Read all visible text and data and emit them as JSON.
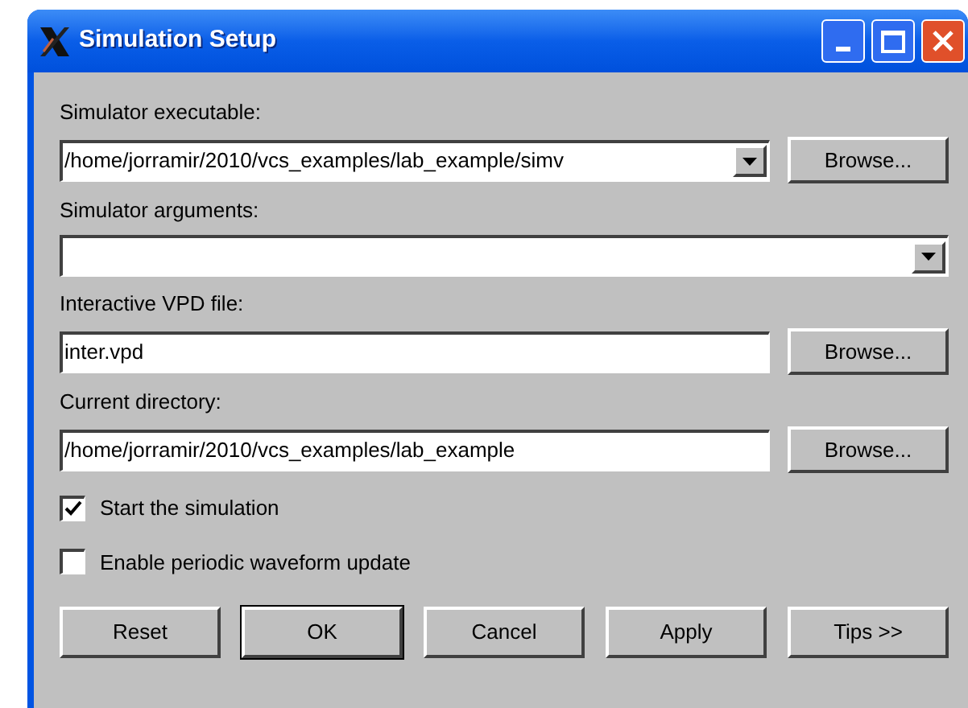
{
  "window": {
    "title": "Simulation Setup"
  },
  "fields": [
    {
      "kind": "combo",
      "label": "Simulator executable:",
      "value": "/home/jorramir/2010/vcs_examples/lab_example/simv",
      "button": "Browse..."
    },
    {
      "kind": "combo",
      "label": "Simulator arguments:"
    },
    {
      "kind": "text",
      "label": "Interactive VPD file:",
      "value": "inter.vpd",
      "button": "Browse..."
    },
    {
      "kind": "text",
      "label": "Current directory:",
      "value": "/home/jorramir/2010/vcs_examples/lab_example",
      "button": "Browse..."
    }
  ],
  "checkboxes": [
    {
      "label": "Start the simulation",
      "checked": true
    },
    {
      "label": "Enable periodic waveform update",
      "checked": false
    }
  ],
  "buttons": [
    {
      "label": "Reset",
      "default": false
    },
    {
      "label": "OK",
      "default": true
    },
    {
      "label": "Cancel",
      "default": false
    },
    {
      "label": "Apply",
      "default": false
    },
    {
      "label": "Tips >>",
      "default": false
    }
  ]
}
